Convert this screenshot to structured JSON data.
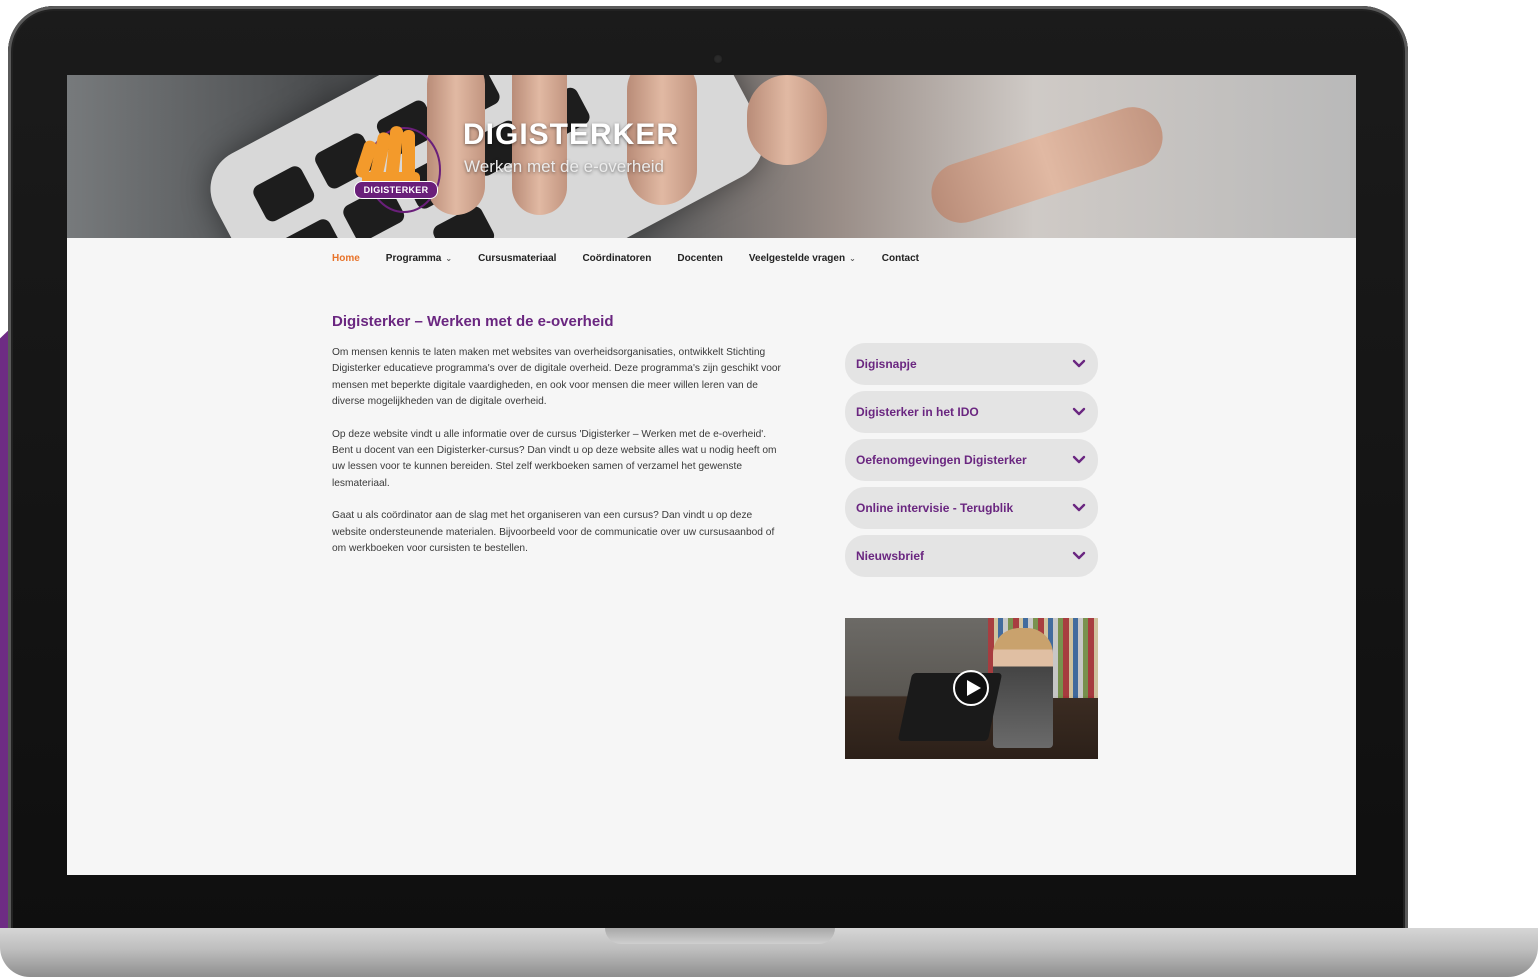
{
  "header": {
    "site_title": "DIGISTERKER",
    "tagline": "Werken met de e-overheid",
    "logo_badge": "DIGISTERKER"
  },
  "nav": {
    "items": [
      {
        "label": "Home",
        "active": true,
        "has_dropdown": false
      },
      {
        "label": "Programma",
        "active": false,
        "has_dropdown": true
      },
      {
        "label": "Cursusmateriaal",
        "active": false,
        "has_dropdown": false
      },
      {
        "label": "Coördinatoren",
        "active": false,
        "has_dropdown": false
      },
      {
        "label": "Docenten",
        "active": false,
        "has_dropdown": false
      },
      {
        "label": "Veelgestelde vragen",
        "active": false,
        "has_dropdown": true
      },
      {
        "label": "Contact",
        "active": false,
        "has_dropdown": false
      }
    ]
  },
  "main": {
    "title": "Digisterker – Werken met de e-overheid",
    "paragraphs": [
      "Om mensen kennis te laten maken met websites van overheidsorganisaties, ontwikkelt Stichting Digisterker educatieve programma's over de digitale overheid. Deze programma's zijn geschikt voor mensen met beperkte digitale vaardigheden, en ook voor mensen die meer willen leren van de diverse mogelijkheden van de digitale overheid.",
      "Op deze website vindt u alle informatie over de cursus 'Digisterker – Werken met de e-overheid'. Bent u docent van een Digisterker-cursus? Dan vindt u op deze website alles wat u nodig heeft om uw lessen voor te kunnen bereiden. Stel zelf werkboeken samen of verzamel het gewenste lesmateriaal.",
      "Gaat u als coördinator aan de slag met het organiseren van een cursus? Dan vindt u op deze website ondersteunende materialen. Bijvoorbeeld voor de communicatie over uw cursusaanbod of om werkboeken voor cursisten te bestellen."
    ]
  },
  "sidebar": {
    "accordion": [
      {
        "label": "Digisnapje"
      },
      {
        "label": "Digisterker in het IDO"
      },
      {
        "label": "Oefenomgevingen Digisterker"
      },
      {
        "label": "Online intervisie - Terugblik"
      },
      {
        "label": "Nieuwsbrief"
      }
    ]
  },
  "colors": {
    "brand_purple": "#6a2680",
    "nav_active": "#e8732a",
    "logo_orange": "#f39a2b"
  },
  "icons": {
    "dropdown": "chevron-down-icon",
    "accordion": "chevron-down-icon",
    "video": "play-icon"
  }
}
